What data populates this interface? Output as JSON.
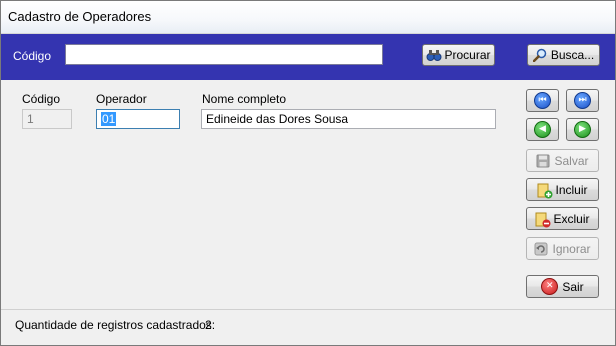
{
  "window": {
    "title": "Cadastro de Operadores"
  },
  "search": {
    "label": "Código",
    "value": "",
    "procurar_label": "Procurar",
    "busca_label": "Busca..."
  },
  "form": {
    "codigo_label": "Código",
    "codigo_value": "1",
    "operador_label": "Operador",
    "operador_value": "01",
    "nome_label": "Nome completo",
    "nome_value": "Edineide das Dores Sousa"
  },
  "navigation": [
    {
      "name": "first-record",
      "icon": "skip-back-icon"
    },
    {
      "name": "last-record",
      "icon": "skip-forward-icon"
    },
    {
      "name": "previous-record",
      "icon": "arrow-left-icon"
    },
    {
      "name": "next-record",
      "icon": "arrow-right-icon"
    }
  ],
  "actions": {
    "salvar": "Salvar",
    "incluir": "Incluir",
    "excluir": "Excluir",
    "ignorar": "Ignorar",
    "sair": "Sair"
  },
  "status": {
    "count_label": "Quantidade de registros cadastrados:",
    "count_value": "2"
  },
  "colors": {
    "search_bar_bg": "#3434b0",
    "selection_bg": "#3399ff"
  }
}
